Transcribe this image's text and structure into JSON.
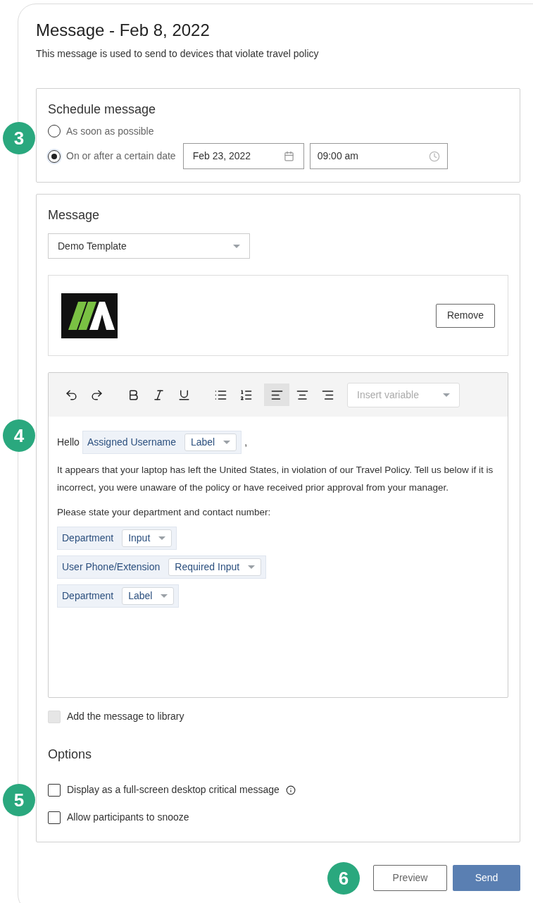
{
  "header": {
    "title": "Message - Feb 8, 2022",
    "subtitle": "This message is used to send to devices that violate travel policy"
  },
  "schedule": {
    "title": "Schedule message",
    "options": [
      {
        "label": "As soon as possible",
        "selected": false
      },
      {
        "label": "On or after a certain date",
        "selected": true,
        "date": "Feb 23, 2022",
        "time": "09:00 am"
      }
    ]
  },
  "message": {
    "title": "Message",
    "template": "Demo Template",
    "remove_button": "Remove",
    "toolbar": [
      {
        "kind": "undo",
        "selected": false
      },
      {
        "kind": "redo",
        "selected": false
      },
      {
        "kind": "bold",
        "selected": false
      },
      {
        "kind": "italic",
        "selected": false
      },
      {
        "kind": "underline",
        "selected": false
      },
      {
        "kind": "bullets",
        "selected": false
      },
      {
        "kind": "numbers",
        "selected": false
      },
      {
        "kind": "align-left",
        "selected": true
      },
      {
        "kind": "align-center",
        "selected": false
      },
      {
        "kind": "align-right",
        "selected": false
      }
    ],
    "insert_variable": {
      "placeholder": "Insert variable"
    },
    "body": [
      {
        "kind": "greeting",
        "text": "Hello",
        "variable": {
          "name": "Assigned Username",
          "type": "Label"
        },
        "after": ","
      },
      {
        "kind": "paragraph",
        "text": "It appears that your laptop has left the United States, in violation of our Travel Policy. Tell us below if it is incorrect, you were unaware of the policy or have received prior approval from your manager."
      },
      {
        "kind": "paragraph",
        "text": "Please state your department and contact number:"
      },
      {
        "kind": "variable",
        "name": "Department",
        "type": "Input"
      },
      {
        "kind": "variable",
        "name": "User Phone/Extension",
        "type": "Required Input"
      },
      {
        "kind": "variable",
        "name": "Department",
        "type": "Label"
      }
    ],
    "library": {
      "label": "Add the message to library",
      "checked": false,
      "disabled": true
    }
  },
  "options": {
    "title": "Options",
    "items": [
      {
        "label": "Display as a full-screen desktop critical message",
        "checked": false,
        "info": true
      },
      {
        "label": "Allow participants to snooze",
        "checked": false,
        "info": false
      }
    ]
  },
  "buttons": [
    {
      "label": "Preview",
      "kind": "secondary"
    },
    {
      "label": "Send",
      "kind": "primary"
    }
  ],
  "callouts": [
    "3",
    "4",
    "5",
    "6"
  ]
}
